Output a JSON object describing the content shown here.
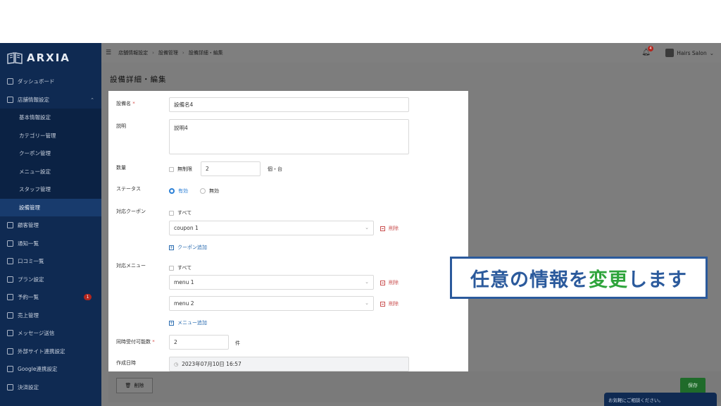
{
  "brand": {
    "name": "ARXIA"
  },
  "sidebar": {
    "items": [
      {
        "label": "ダッシュボード",
        "icon": "dashboard-icon"
      },
      {
        "label": "店舗情報設定",
        "icon": "store-icon"
      },
      {
        "label": "顧客管理",
        "icon": "customer-icon"
      },
      {
        "label": "通知一覧",
        "icon": "notice-icon"
      },
      {
        "label": "口コミ一覧",
        "icon": "review-icon"
      },
      {
        "label": "プラン設定",
        "icon": "plan-icon"
      },
      {
        "label": "予約一覧",
        "icon": "reservation-icon"
      },
      {
        "label": "売上管理",
        "icon": "sales-icon"
      },
      {
        "label": "メッセージ送信",
        "icon": "message-icon"
      },
      {
        "label": "外部サイト連携設定",
        "icon": "link-icon"
      },
      {
        "label": "Google連携設定",
        "icon": "location-icon"
      },
      {
        "label": "決済設定",
        "icon": "payment-icon"
      }
    ],
    "sub_items": [
      "基本情報設定",
      "カテゴリー管理",
      "クーポン管理",
      "メニュー設定",
      "スタッフ管理",
      "設備管理"
    ],
    "reservation_badge": "1"
  },
  "header": {
    "breadcrumb": [
      "店舗情報設定",
      "設備管理",
      "設備詳細・編集"
    ],
    "notification_count": "4",
    "user_name": "Hairs Salon"
  },
  "page": {
    "title": "設備詳細・編集"
  },
  "form": {
    "name_label": "設備名",
    "required_mark": "*",
    "name_value": "設備名4",
    "description_label": "説明",
    "description_value": "説明4",
    "quantity_label": "数量",
    "unlimited_label": "無制限",
    "quantity_value": "2",
    "quantity_unit": "個・台",
    "status_label": "ステータス",
    "status_active": "有効",
    "status_inactive": "無効",
    "coupon_label": "対応クーポン",
    "all_label": "すべて",
    "coupons": [
      "coupon 1"
    ],
    "delete_label": "削除",
    "add_coupon_label": "クーポン追加",
    "menu_label": "対応メニュー",
    "menus": [
      "menu 1",
      "menu 2"
    ],
    "add_menu_label": "メニュー追加",
    "concurrent_label": "同時受付可能数",
    "concurrent_value": "2",
    "concurrent_unit": "件",
    "created_label": "作成日時",
    "created_value": "2023年07月10日 16:57"
  },
  "footer": {
    "delete_button": "削除",
    "save_button": "保存",
    "chat_label": "お気軽にご相談ください。"
  },
  "callout": {
    "text_before": "任意の情報を",
    "text_highlight": "変更",
    "text_after": "します"
  },
  "colors": {
    "sidebar": "#0f2a52",
    "accent": "#2b7fd6",
    "save": "#1f6b2a",
    "callout": "#2b5a9c",
    "highlight": "#2ea43b"
  }
}
